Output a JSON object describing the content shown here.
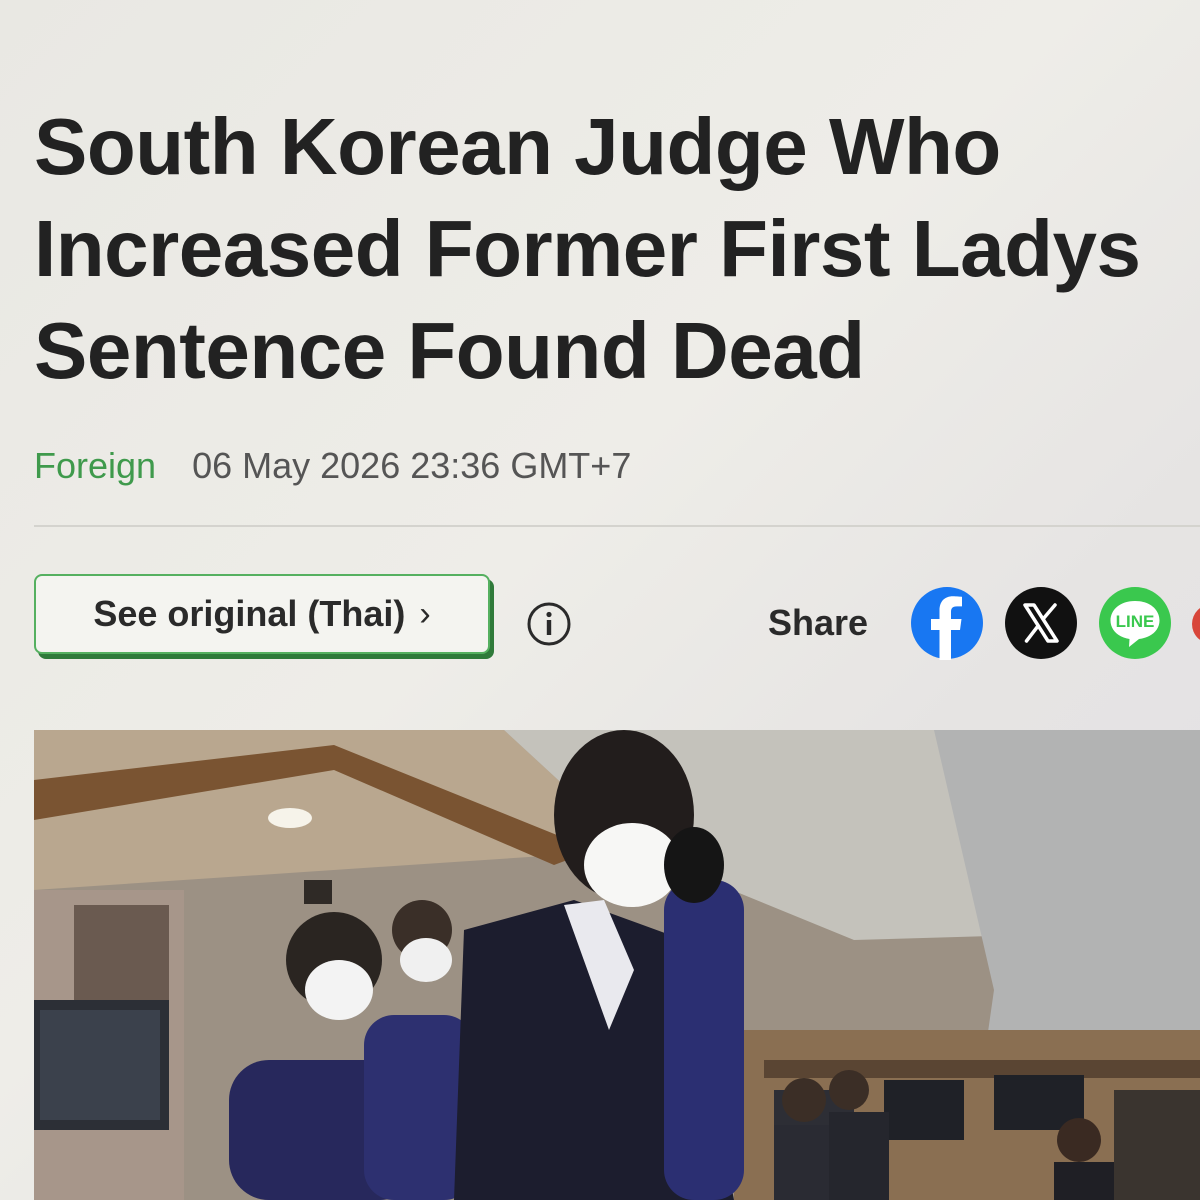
{
  "article": {
    "headline_line1": "South Korean Judge Who",
    "headline_line2": "Increased Former First Ladys",
    "headline_line3": "Sentence Found Dead",
    "category": "Foreign",
    "published": "06 May 2026 23:36 GMT+7"
  },
  "toolbar": {
    "see_original_label": "See original (Thai)",
    "see_original_chevron": "›",
    "info_icon": "info-circle-icon",
    "share_label": "Share",
    "share_targets": [
      {
        "name": "facebook",
        "icon": "facebook-icon",
        "color": "#1877f2"
      },
      {
        "name": "x",
        "icon": "x-icon",
        "color": "#111111"
      },
      {
        "name": "line",
        "icon": "line-icon",
        "label": "LINE",
        "color": "#3ac84e"
      }
    ]
  },
  "colors": {
    "category": "#3f9a4c",
    "button_border": "#55b060",
    "button_shadow": "#2f7a3a"
  }
}
